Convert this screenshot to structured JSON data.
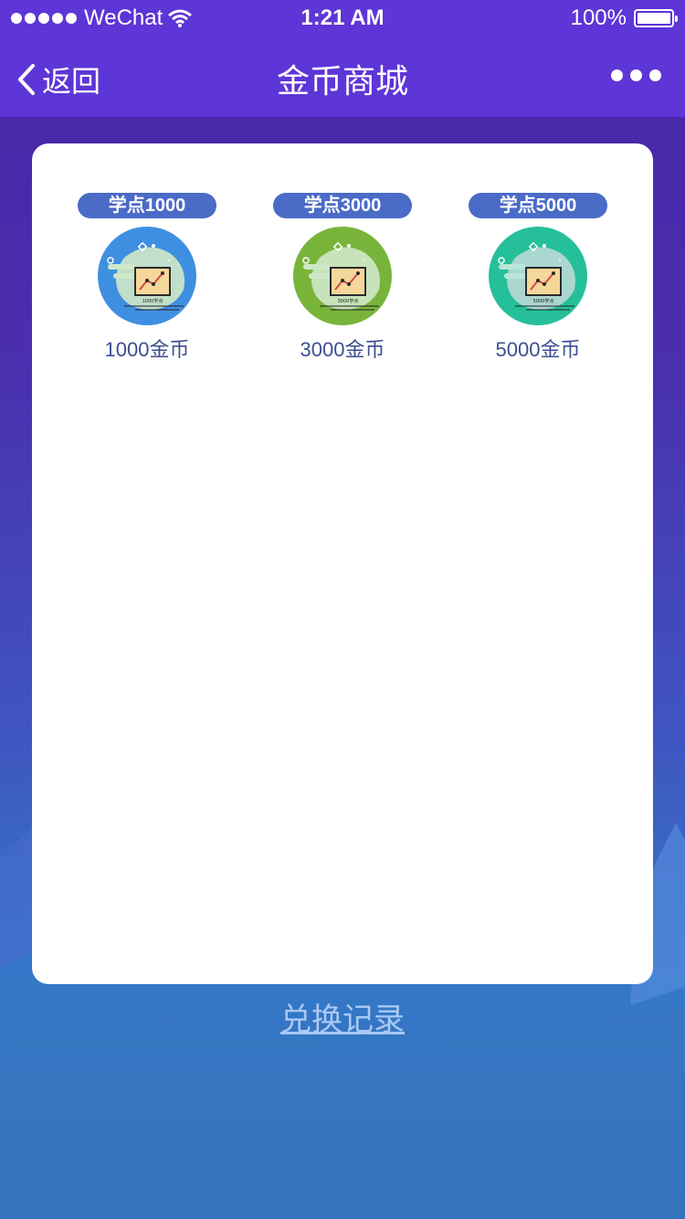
{
  "status_bar": {
    "carrier": "WeChat",
    "time": "1:21 AM",
    "battery": "100%"
  },
  "nav": {
    "back_label": "返回",
    "title": "金币商城"
  },
  "products": [
    {
      "badge": "学点1000",
      "icon_text": "1000学点",
      "label": "1000金币",
      "color": "#3f8fe0"
    },
    {
      "badge": "学点3000",
      "icon_text": "3000学点",
      "label": "3000金币",
      "color": "#79b43a"
    },
    {
      "badge": "学点5000",
      "icon_text": "5000学点",
      "label": "5000金币",
      "color": "#25bf9a"
    }
  ],
  "footer": {
    "record_link": "兑换记录"
  },
  "colors": {
    "nav_bg": "#5e35d6",
    "badge_bg": "#4a6bc6",
    "label_text": "#3d4f8f",
    "link": "#a9c8f5"
  }
}
